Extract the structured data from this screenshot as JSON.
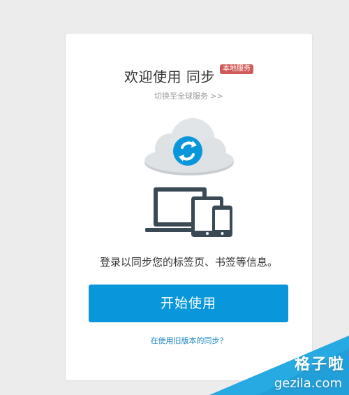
{
  "card": {
    "title": "欢迎使用 同步",
    "badge": "本地服务",
    "switch_link": "切换至全球服务 >>",
    "description": "登录以同步您的标签页、书签等信息。",
    "start_button": "开始使用",
    "old_version_link": "在使用旧版本的同步？"
  },
  "illustration": {
    "icons": [
      "cloud-sync-icon",
      "laptop-icon",
      "tablet-icon",
      "phone-icon"
    ]
  },
  "watermark": {
    "title": "格子啦",
    "subtitle": "gezila.com"
  },
  "colors": {
    "background": "#ececec",
    "card": "#ffffff",
    "accent": "#0996da",
    "badge": "#d05a5a",
    "link": "#1b87c8",
    "device": "#3a4a55",
    "cloud": "#dfe2e5",
    "watermark": "#27a9e1"
  }
}
